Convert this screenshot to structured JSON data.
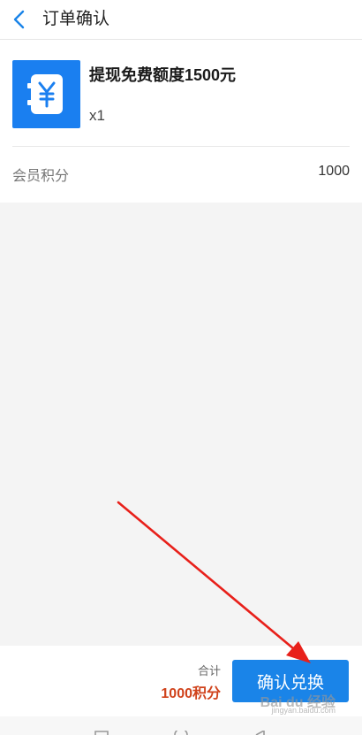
{
  "header": {
    "back_icon": "chevron-left-icon",
    "title": "订单确认"
  },
  "product": {
    "icon": "yen-wallet-icon",
    "name": "提现免费额度1500元",
    "quantity": "x1"
  },
  "points_row": {
    "label": "会员积分",
    "value": "1000"
  },
  "footer": {
    "total_label": "合计",
    "total_value": "1000积分",
    "confirm_label": "确认兑换"
  },
  "watermark": {
    "brand": "Bai du 经验",
    "sub": "jingyan.baidu.com"
  },
  "colors": {
    "accent": "#1a84e8",
    "price": "#d0421b",
    "annotation_arrow": "#e8201a"
  }
}
